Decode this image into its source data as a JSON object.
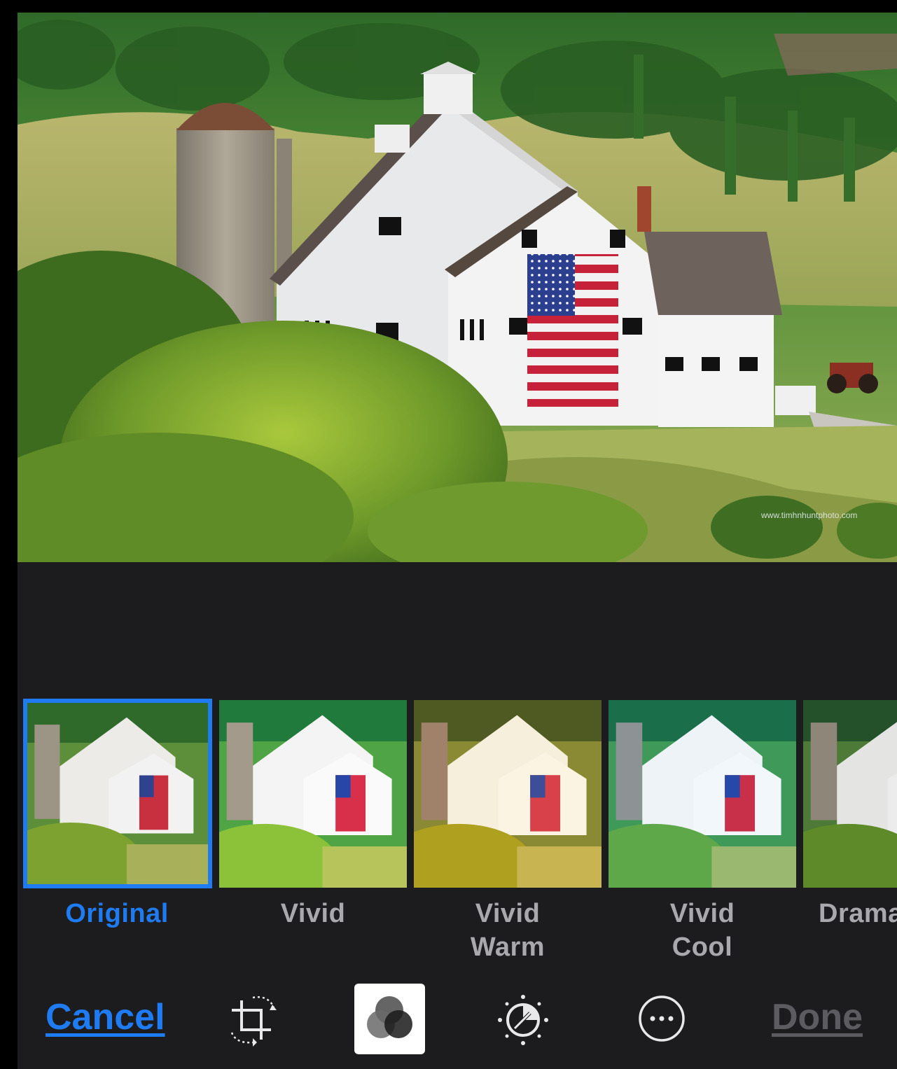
{
  "photo": {
    "description_icon": "barn-photo",
    "watermark": "www.timhnhuntphoto.com"
  },
  "filters": [
    {
      "label": "Original",
      "selected": true
    },
    {
      "label": "Vivid",
      "selected": false
    },
    {
      "label": "Vivid\nWarm",
      "selected": false
    },
    {
      "label": "Vivid\nCool",
      "selected": false
    },
    {
      "label": "Dramatic",
      "selected": false
    }
  ],
  "toolbar": {
    "cancel_label": "Cancel",
    "done_label": "Done",
    "icons": [
      "crop-rotate-icon",
      "filters-icon",
      "adjust-dial-icon",
      "more-options-icon"
    ]
  },
  "colors": {
    "accent": "#1e7bf2",
    "background": "#1c1c1e",
    "label_inactive": "#a9a9ad",
    "done_disabled": "#5c5c60"
  }
}
